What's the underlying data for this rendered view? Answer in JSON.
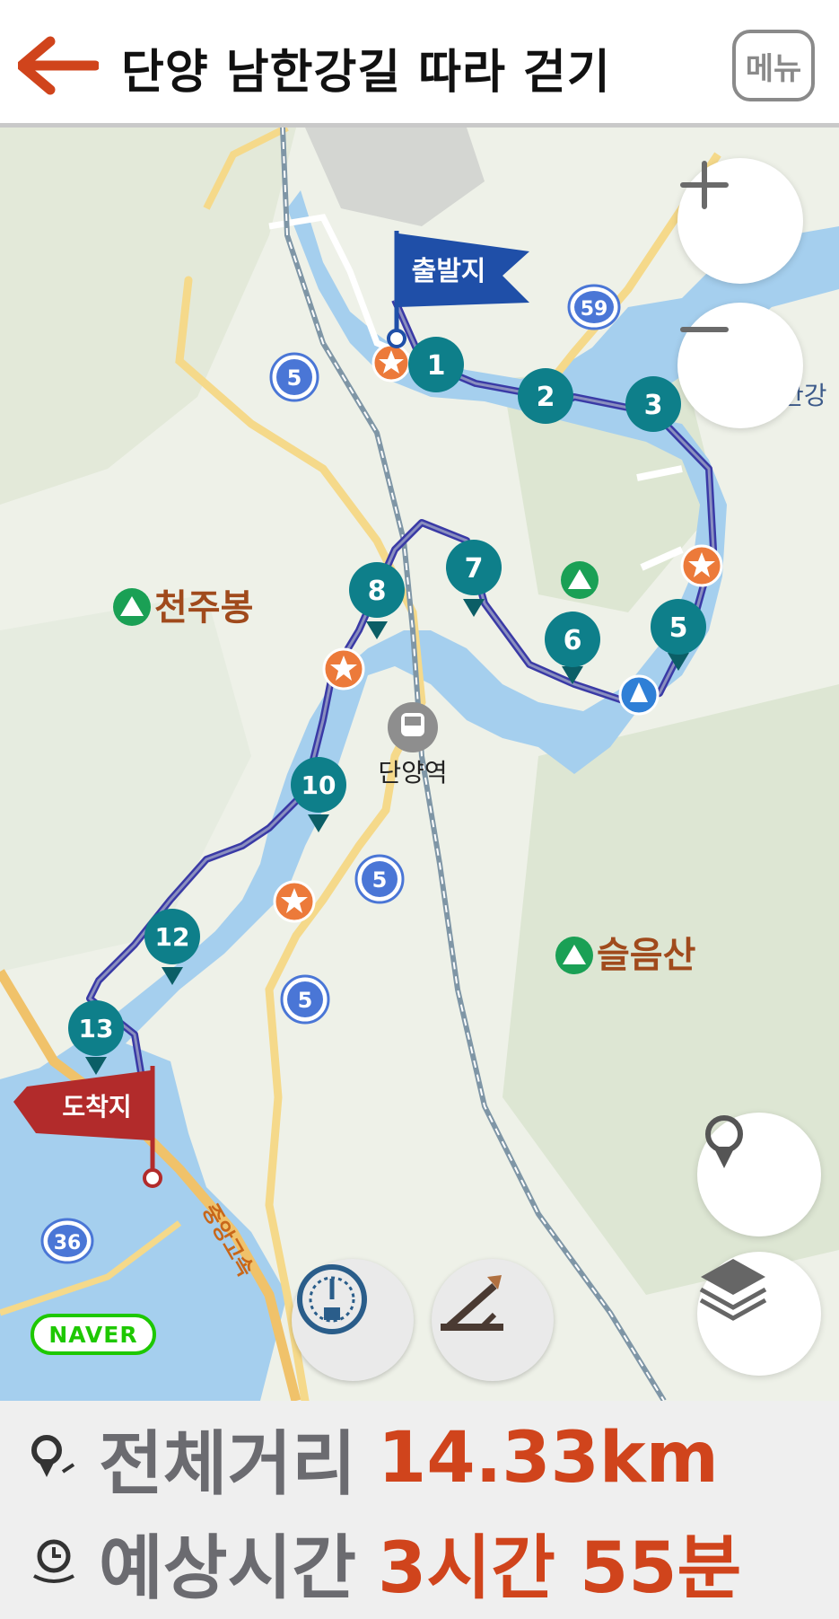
{
  "header": {
    "title": "단양 남한강길 따라 걷기",
    "menu_label": "메뉴"
  },
  "map": {
    "start_label": "출발지",
    "end_label": "도착지",
    "station_label": "단양역",
    "peak_labels": [
      "천주봉",
      "슬음산"
    ],
    "road_labels": [
      "59",
      "5",
      "5",
      "5",
      "36"
    ],
    "river_label": "한강",
    "expressway_label": "중앙고속",
    "waypoints": [
      "1",
      "2",
      "3",
      "5",
      "6",
      "7",
      "8",
      "10",
      "12",
      "13"
    ],
    "scale_label": "0",
    "provider": "NAVER",
    "colors": {
      "route": "#3a3aa6",
      "waypoint": "#0e7f8a",
      "water": "#a5cfee",
      "accent": "#d0441c"
    }
  },
  "footer": {
    "distance_label": "전체거리",
    "distance_value": "14.33km",
    "time_label": "예상시간",
    "time_value": "3시간 55분"
  }
}
